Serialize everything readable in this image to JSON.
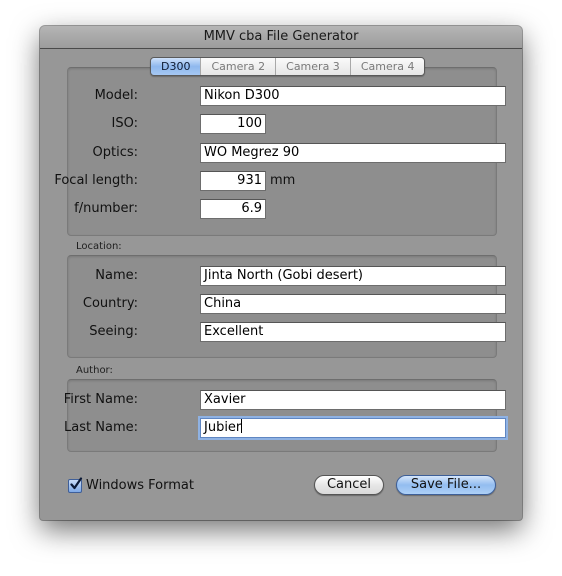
{
  "window": {
    "title": "MMV cba File Generator"
  },
  "tabs": [
    {
      "label": "D300",
      "active": true
    },
    {
      "label": "Camera 2",
      "active": false
    },
    {
      "label": "Camera 3",
      "active": false
    },
    {
      "label": "Camera 4",
      "active": false
    }
  ],
  "camera": {
    "model": {
      "label": "Model:",
      "value": "Nikon D300"
    },
    "iso": {
      "label": "ISO:",
      "value": "100"
    },
    "optics": {
      "label": "Optics:",
      "value": "WO Megrez 90"
    },
    "focal_length": {
      "label": "Focal length:",
      "value": "931",
      "unit": "mm"
    },
    "f_number": {
      "label": "f/number:",
      "value": "6.9"
    }
  },
  "location": {
    "section_label": "Location:",
    "name": {
      "label": "Name:",
      "value": "Jinta North (Gobi desert)"
    },
    "country": {
      "label": "Country:",
      "value": "China"
    },
    "seeing": {
      "label": "Seeing:",
      "value": "Excellent"
    }
  },
  "author": {
    "section_label": "Author:",
    "first_name": {
      "label": "First Name:",
      "value": "Xavier"
    },
    "last_name": {
      "label": "Last Name:",
      "value": "Jubier"
    }
  },
  "footer": {
    "windows_format": {
      "label": "Windows Format",
      "checked": true
    },
    "cancel_label": "Cancel",
    "save_label": "Save File..."
  }
}
